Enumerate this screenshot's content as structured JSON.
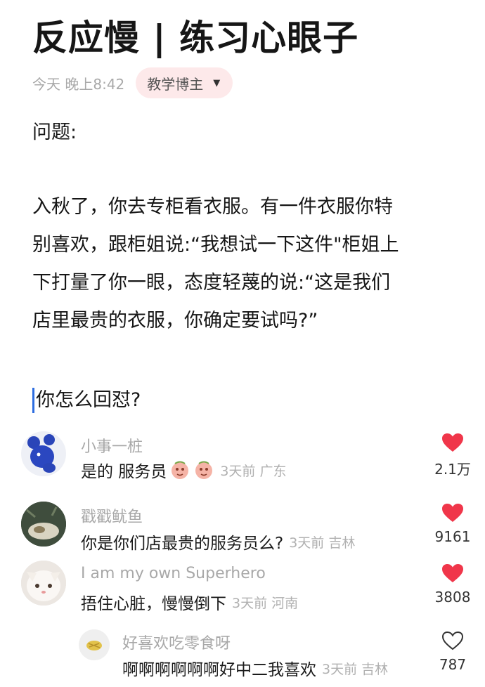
{
  "post": {
    "title": "反应慢 | 练习心眼子",
    "time": "今天 晚上8:42",
    "tag": "教学博主",
    "question_label": "问题:",
    "paragraph_lines": [
      "入秋了，你去专柜看衣服。有一件衣服你特",
      "别喜欢，跟柜姐说:“我想试一下这件\"柜姐上",
      "下打量了你一眼，态度轻蔑的说:“这是我们",
      "店里最贵的衣服，你确定要试吗?”"
    ],
    "ask": "你怎么回怼?"
  },
  "comments": [
    {
      "name": "小事一桩",
      "text": "是的 服务员",
      "meta": "3天前 广东",
      "likes": "2.1万",
      "liked": true
    },
    {
      "name": "戳戳鱿鱼",
      "text": "你是你们店最贵的服务员么?",
      "meta": "3天前 吉林",
      "likes": "9161",
      "liked": true
    },
    {
      "name": "I am my own Superhero",
      "text": "捂住心脏，慢慢倒下",
      "meta": "3天前 河南",
      "likes": "3808",
      "liked": true
    },
    {
      "name": "好喜欢吃零食呀",
      "text": "啊啊啊啊啊啊好中二我喜欢",
      "meta": "3天前 吉林",
      "likes": "787",
      "liked": false
    }
  ],
  "colors": {
    "heart": "#f0364a",
    "tag_bg": "#fde9ea",
    "cursor": "#2d6de0"
  }
}
